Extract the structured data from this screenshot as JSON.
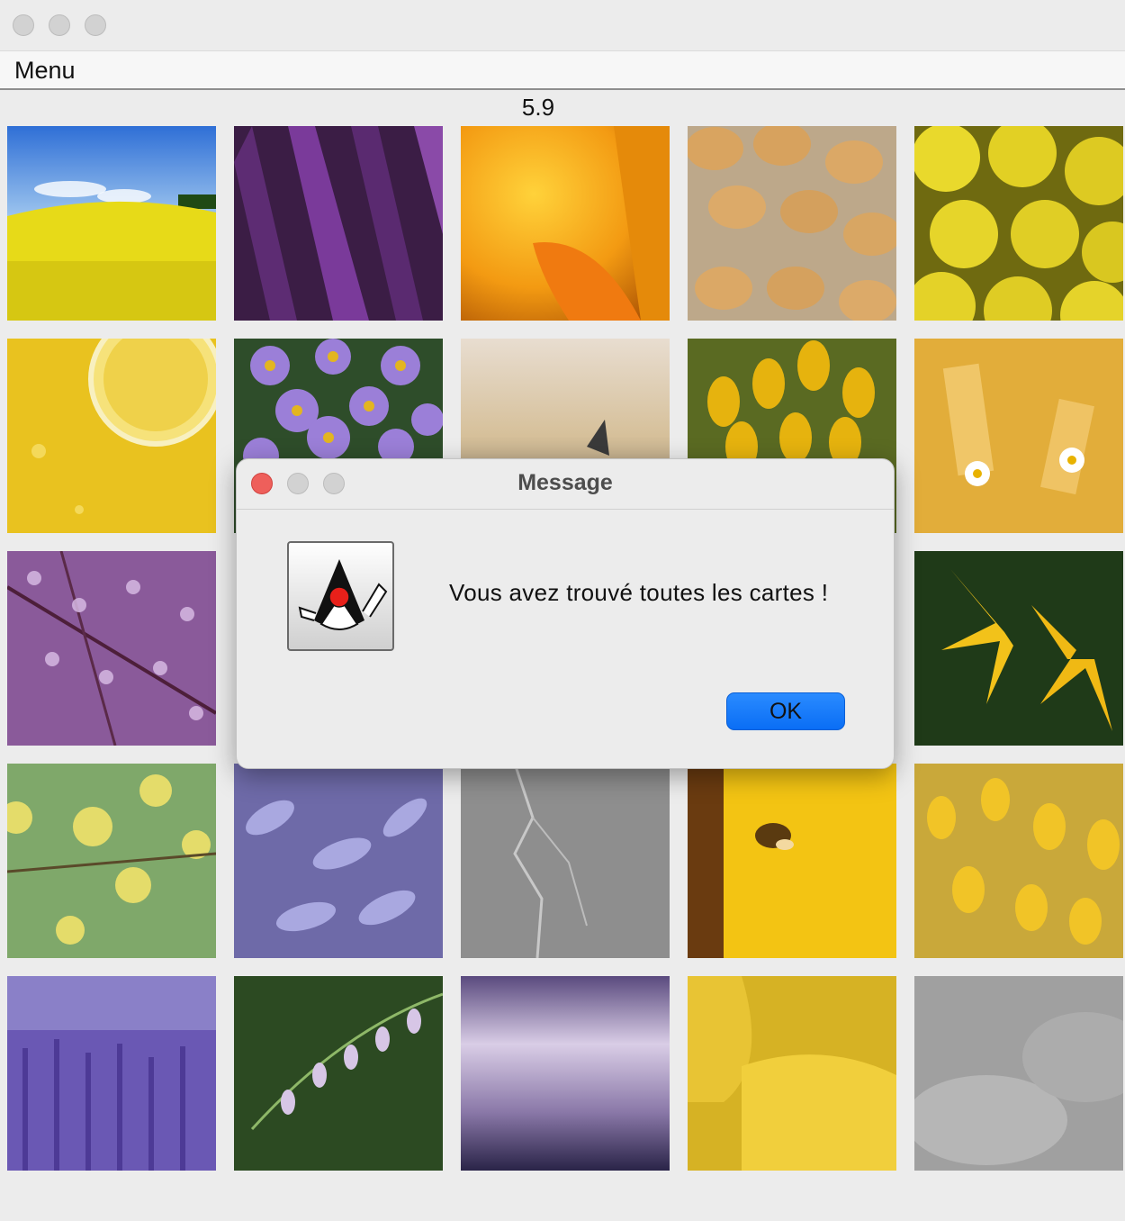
{
  "menubar": {
    "menu_label": "Menu"
  },
  "score": {
    "value": "5.9"
  },
  "dialog": {
    "title": "Message",
    "message": "Vous avez trouvé toutes les cartes !",
    "ok_label": "OK",
    "icon": "java-duke-icon"
  },
  "colors": {
    "accent": "#0a6ef5",
    "close": "#ee5f5b"
  },
  "grid": {
    "tiles": [
      {
        "icon": "rapeseed-field-image"
      },
      {
        "icon": "purple-feathers-image"
      },
      {
        "icon": "orange-flower-petals-image"
      },
      {
        "icon": "almonds-image"
      },
      {
        "icon": "lemons-image"
      },
      {
        "icon": "lemon-slice-image"
      },
      {
        "icon": "purple-asters-image"
      },
      {
        "icon": "butterfly-image"
      },
      {
        "icon": "yellow-crocus-image"
      },
      {
        "icon": "pasta-daisies-image"
      },
      {
        "icon": "purple-water-drops-image"
      },
      {
        "icon": "hidden-card"
      },
      {
        "icon": "hidden-card"
      },
      {
        "icon": "hidden-card"
      },
      {
        "icon": "yellow-lilies-image"
      },
      {
        "icon": "green-apples-image"
      },
      {
        "icon": "violet-petals-image"
      },
      {
        "icon": "lightning-image"
      },
      {
        "icon": "bee-sunflower-image"
      },
      {
        "icon": "yellow-tulips-image"
      },
      {
        "icon": "lavender-image"
      },
      {
        "icon": "bellflowers-image"
      },
      {
        "icon": "misty-valley-image"
      },
      {
        "icon": "yellow-tulip-closeup-image"
      },
      {
        "icon": "grey-flower-image"
      }
    ]
  }
}
